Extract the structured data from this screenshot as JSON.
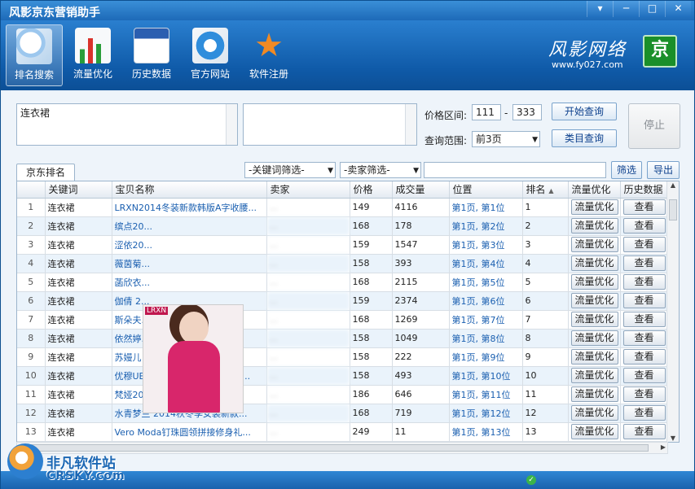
{
  "window": {
    "title": "风影京东营销助手"
  },
  "toolbar": {
    "items": [
      {
        "label": "排名搜索",
        "icon": "magnifier-icon"
      },
      {
        "label": "流量优化",
        "icon": "bar-chart-icon"
      },
      {
        "label": "历史数据",
        "icon": "word-document-icon"
      },
      {
        "label": "官方网站",
        "icon": "ie-browser-icon"
      },
      {
        "label": "软件注册",
        "icon": "star-medal-icon"
      }
    ],
    "brand": "风影网络",
    "brand_url": "www.fy027.com",
    "badge": "京"
  },
  "query": {
    "keywords_text": "连衣裙",
    "price_label": "价格区间:",
    "price_min": "111",
    "price_max": "333",
    "range_label": "查询范围:",
    "range_value": "前3页",
    "start_button": "开始查询",
    "category_button": "类目查询",
    "stop_button": "停止"
  },
  "filters": {
    "keyword_filter": "-关键词筛选-",
    "seller_filter": "-卖家筛选-",
    "filter_button": "筛选",
    "export_button": "导出"
  },
  "tab": {
    "label": "京东排名"
  },
  "table": {
    "headers": [
      "关键词",
      "宝贝名称",
      "卖家",
      "价格",
      "成交量",
      "位置",
      "排名",
      "流量优化",
      "历史数据"
    ],
    "opt_button": "流量优化",
    "view_button": "查看",
    "rows": [
      {
        "n": "1",
        "kw": "连衣裙",
        "name": "LRXN2014冬装新款韩版A字收腰...",
        "seller": "...",
        "price": "149",
        "sales": "4116",
        "pos": "第1页, 第1位",
        "rank": "1"
      },
      {
        "n": "2",
        "kw": "连衣裙",
        "name": "缤点20...",
        "seller": "...",
        "price": "168",
        "sales": "178",
        "pos": "第1页, 第2位",
        "rank": "2"
      },
      {
        "n": "3",
        "kw": "连衣裙",
        "name": "涩依20...",
        "seller": "...",
        "price": "159",
        "sales": "1547",
        "pos": "第1页, 第3位",
        "rank": "3"
      },
      {
        "n": "4",
        "kw": "连衣裙",
        "name": "薇茵菊...",
        "seller": "...",
        "price": "158",
        "sales": "393",
        "pos": "第1页, 第4位",
        "rank": "4"
      },
      {
        "n": "5",
        "kw": "连衣裙",
        "name": "菡欣衣...",
        "seller": "...",
        "price": "168",
        "sales": "2115",
        "pos": "第1页, 第5位",
        "rank": "5"
      },
      {
        "n": "6",
        "kw": "连衣裙",
        "name": "伽倩 2...",
        "seller": "...",
        "price": "159",
        "sales": "2374",
        "pos": "第1页, 第6位",
        "rank": "6"
      },
      {
        "n": "7",
        "kw": "连衣裙",
        "name": "斯朵夫...",
        "seller": "...",
        "price": "168",
        "sales": "1269",
        "pos": "第1页, 第7位",
        "rank": "7"
      },
      {
        "n": "8",
        "kw": "连衣裙",
        "name": "依然婷...",
        "seller": "...",
        "price": "158",
        "sales": "1049",
        "pos": "第1页, 第8位",
        "rank": "8"
      },
      {
        "n": "9",
        "kw": "连衣裙",
        "name": "苏嫚儿 2014秋冬季新款女装 ...",
        "seller": "...",
        "price": "158",
        "sales": "222",
        "pos": "第1页, 第9位",
        "rank": "9"
      },
      {
        "n": "10",
        "kw": "连衣裙",
        "name": "优穆UEOM 2014秋装 韩版包臀...",
        "seller": "...",
        "price": "158",
        "sales": "493",
        "pos": "第1页, 第10位",
        "rank": "10"
      },
      {
        "n": "11",
        "kw": "连衣裙",
        "name": "梵娅2014冬季女装韩版加绒长...",
        "seller": "...",
        "price": "186",
        "sales": "646",
        "pos": "第1页, 第11位",
        "rank": "11"
      },
      {
        "n": "12",
        "kw": "连衣裙",
        "name": "水青梦兰 2014秋冬季女装新款...",
        "seller": "...",
        "price": "168",
        "sales": "719",
        "pos": "第1页, 第12位",
        "rank": "12"
      },
      {
        "n": "13",
        "kw": "连衣裙",
        "name": "Vero Moda钉珠圆领拼接修身礼...",
        "seller": "...",
        "price": "249",
        "sales": "11",
        "pos": "第1页, 第13位",
        "rank": "13"
      }
    ]
  },
  "popup": {
    "tag": "LRXN"
  },
  "watermark": {
    "line1": "非凡软件站",
    "line2": "CRSKY.com"
  },
  "colors": {
    "titlebar": "#1d6ab8",
    "toolbar": "#0f5aa8",
    "link": "#1a5fb0",
    "row_alt": "#eaf3fb"
  }
}
